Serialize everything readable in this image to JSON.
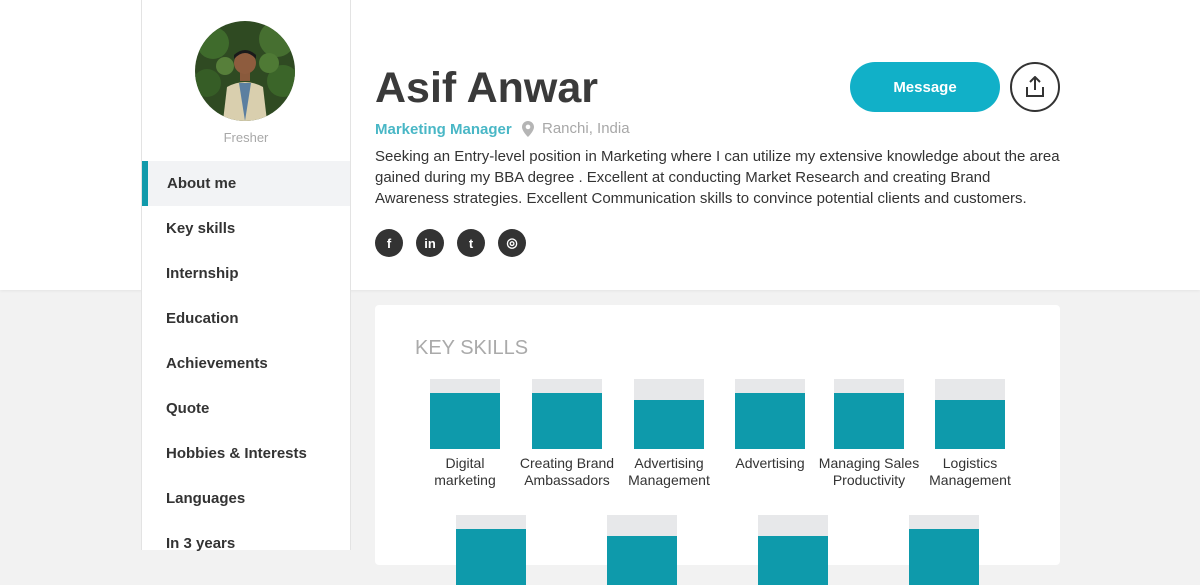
{
  "profile": {
    "name": "Asif Anwar",
    "role": "Marketing Manager",
    "location": "Ranchi, India",
    "level": "Fresher",
    "summary": "Seeking an Entry-level position in Marketing where I can utilize my extensive knowledge about the area gained during my BBA degree . Excellent at conducting Market Research and creating Brand Awareness strategies. Excellent Communication skills to convince potential clients and customers."
  },
  "actions": {
    "message_label": "Message",
    "share_icon": "share-icon"
  },
  "socials": [
    {
      "icon": "facebook-icon",
      "glyph": "f"
    },
    {
      "icon": "linkedin-icon",
      "glyph": "in"
    },
    {
      "icon": "twitter-icon",
      "glyph": "t"
    },
    {
      "icon": "instagram-icon",
      "glyph": "◎"
    }
  ],
  "sidebar": {
    "items": [
      {
        "label": "About me",
        "active": true
      },
      {
        "label": "Key skills"
      },
      {
        "label": "Internship"
      },
      {
        "label": "Education"
      },
      {
        "label": "Achievements"
      },
      {
        "label": "Quote"
      },
      {
        "label": "Hobbies & Interests"
      },
      {
        "label": "Languages"
      },
      {
        "label": "In 3 years"
      }
    ]
  },
  "key_skills": {
    "title": "KEY SKILLS",
    "skills": [
      {
        "label": "Digital marketing",
        "level": 0.8
      },
      {
        "label": "Creating Brand Ambassadors",
        "level": 0.8
      },
      {
        "label": "Advertising Management",
        "level": 0.7
      },
      {
        "label": "Advertising",
        "level": 0.8
      },
      {
        "label": "Managing Sales Productivity",
        "level": 0.8
      },
      {
        "label": "Logistics Management",
        "level": 0.7
      },
      {
        "label": "",
        "level": 0.8
      },
      {
        "label": "",
        "level": 0.7
      },
      {
        "label": "",
        "level": 0.7
      },
      {
        "label": "",
        "level": 0.8
      }
    ]
  },
  "colors": {
    "accent": "#11b0c8",
    "bar_fill": "#0e9aab",
    "bar_track": "#e7e8ea",
    "role": "#49b7c6"
  }
}
